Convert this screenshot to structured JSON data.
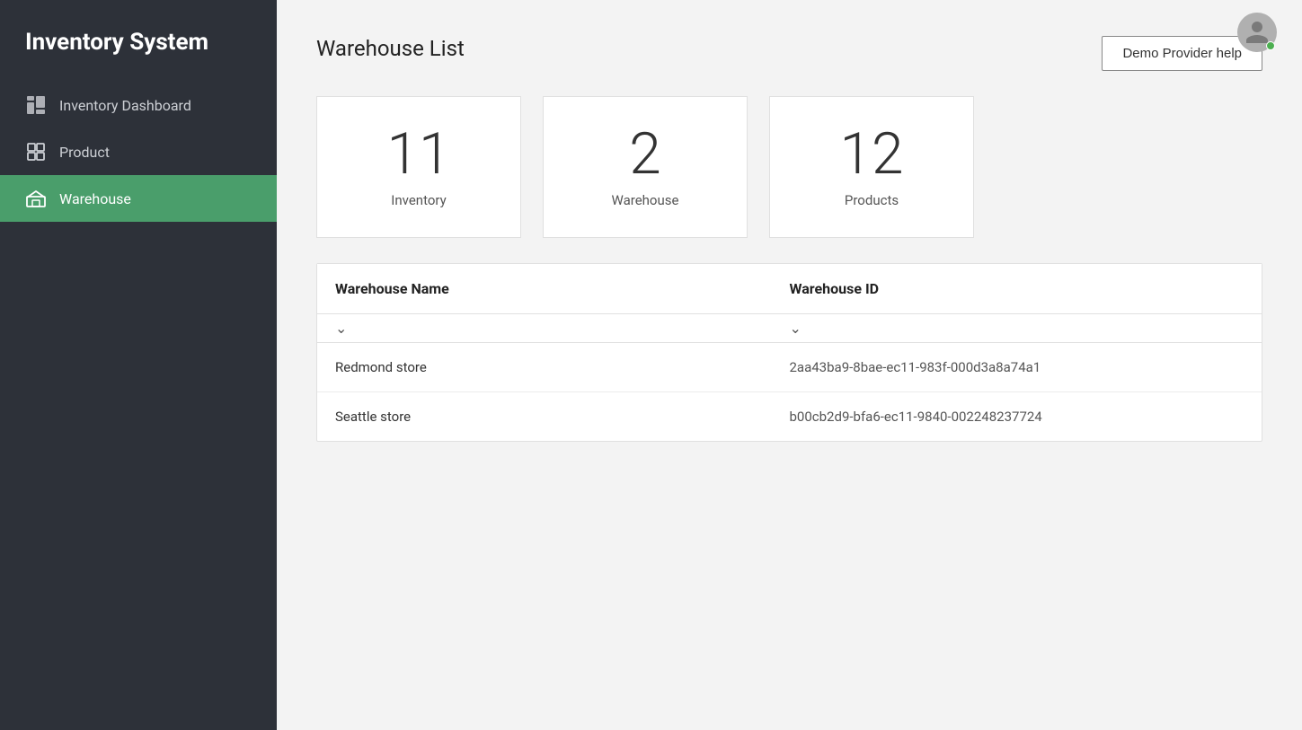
{
  "app": {
    "title": "Inventory System"
  },
  "sidebar": {
    "nav_items": [
      {
        "id": "inventory-dashboard",
        "label": "Inventory Dashboard",
        "icon": "dashboard-icon",
        "active": false
      },
      {
        "id": "product",
        "label": "Product",
        "icon": "product-icon",
        "active": false
      },
      {
        "id": "warehouse",
        "label": "Warehouse",
        "icon": "warehouse-icon",
        "active": true
      }
    ]
  },
  "main": {
    "page_title": "Warehouse List",
    "demo_help_btn": "Demo Provider help",
    "stats": [
      {
        "number": "11",
        "label": "Inventory"
      },
      {
        "number": "2",
        "label": "Warehouse"
      },
      {
        "number": "12",
        "label": "Products"
      }
    ],
    "table": {
      "col1_header": "Warehouse Name",
      "col2_header": "Warehouse ID",
      "rows": [
        {
          "name": "Redmond store",
          "id": "2aa43ba9-8bae-ec11-983f-000d3a8a74a1"
        },
        {
          "name": "Seattle store",
          "id": "b00cb2d9-bfa6-ec11-9840-002248237724"
        }
      ]
    }
  }
}
